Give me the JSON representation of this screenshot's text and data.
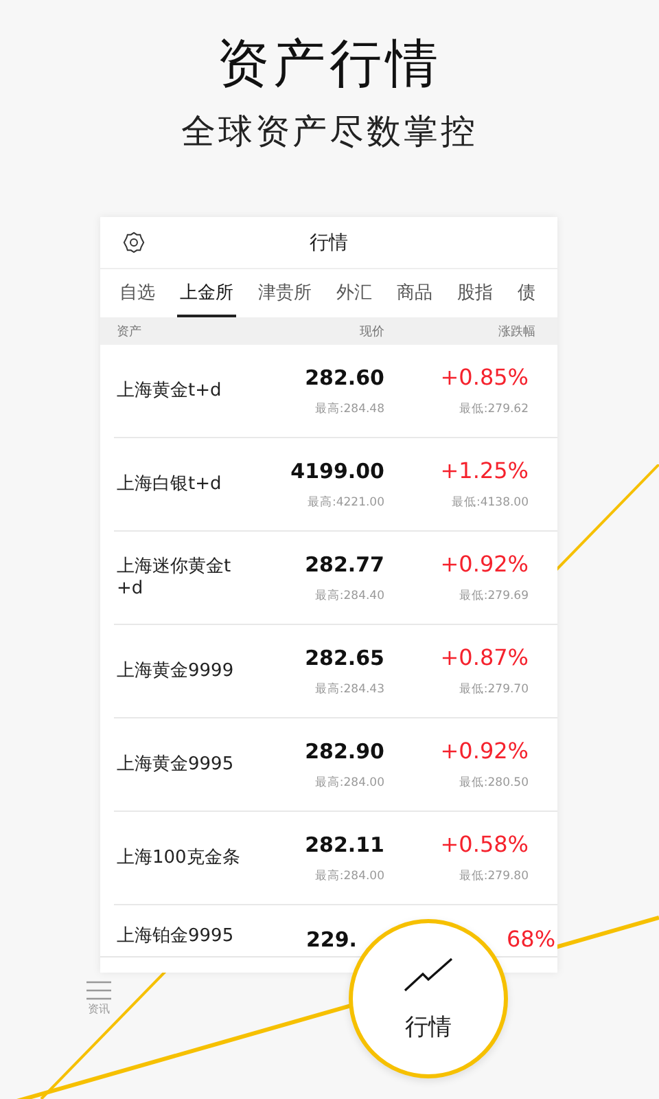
{
  "headline": "资产行情",
  "subheadline": "全球资产尽数掌控",
  "screen": {
    "title": "行情",
    "tabs": [
      {
        "label": "自选",
        "selected": false
      },
      {
        "label": "上金所",
        "selected": true
      },
      {
        "label": "津贵所",
        "selected": false
      },
      {
        "label": "外汇",
        "selected": false
      },
      {
        "label": "商品",
        "selected": false
      },
      {
        "label": "股指",
        "selected": false
      },
      {
        "label": "债",
        "selected": false
      }
    ],
    "columns": [
      "资产",
      "现价",
      "涨跌幅"
    ],
    "rows": [
      {
        "name": "上海黄金t+d",
        "price": "282.60",
        "change": "+0.85%",
        "high": "最高:284.48",
        "low": "最低:279.62"
      },
      {
        "name": "上海白银t+d",
        "price": "4199.00",
        "change": "+1.25%",
        "high": "最高:4221.00",
        "low": "最低:4138.00"
      },
      {
        "name": "上海迷你黄金t+d",
        "price": "282.77",
        "change": "+0.92%",
        "high": "最高:284.40",
        "low": "最低:279.69"
      },
      {
        "name": "上海黄金9999",
        "price": "282.65",
        "change": "+0.87%",
        "high": "最高:284.43",
        "low": "最低:279.70"
      },
      {
        "name": "上海黄金9995",
        "price": "282.90",
        "change": "+0.92%",
        "high": "最高:284.00",
        "low": "最低:280.50"
      },
      {
        "name": "上海100克金条",
        "price": "282.11",
        "change": "+0.58%",
        "high": "最高:284.00",
        "low": "最低:279.80"
      },
      {
        "name": "上海铂金9995",
        "price": "229.",
        "change": "68%"
      }
    ],
    "nav": [
      {
        "label": "资讯",
        "selected": false
      }
    ],
    "magnifier": {
      "label": "行情",
      "selected": true
    }
  }
}
